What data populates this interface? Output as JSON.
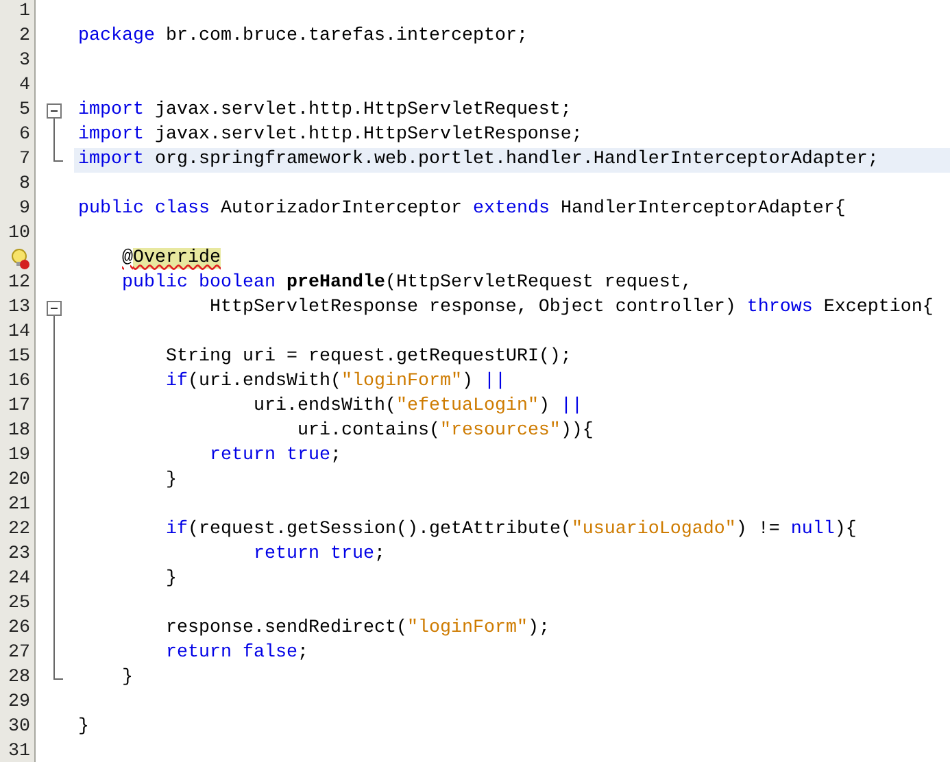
{
  "editor": {
    "lines": [
      {
        "number": "1",
        "kind": "plain",
        "current": false
      },
      {
        "number": "2",
        "kind": "plain",
        "current": false,
        "tokens": [
          {
            "kind": "keyword",
            "text": "package"
          },
          {
            "kind": "plain",
            "text": " br.com.bruce.tarefas.interceptor;"
          }
        ]
      },
      {
        "number": "3",
        "kind": "plain",
        "current": false
      },
      {
        "number": "4",
        "kind": "plain",
        "current": false
      },
      {
        "number": "5",
        "kind": "foldstart",
        "current": false,
        "tokens": [
          {
            "kind": "keyword",
            "text": "import"
          },
          {
            "kind": "plain",
            "text": " javax.servlet.http.HttpServletRequest;"
          }
        ]
      },
      {
        "number": "6",
        "kind": "foldbody",
        "current": false,
        "tokens": [
          {
            "kind": "keyword",
            "text": "import"
          },
          {
            "kind": "plain",
            "text": " javax.servlet.http.HttpServletResponse;"
          }
        ]
      },
      {
        "number": "7",
        "kind": "foldend",
        "current": true,
        "tokens": [
          {
            "kind": "keyword",
            "text": "import"
          },
          {
            "kind": "plain",
            "text": " org.springframework.web.portlet.handler.HandlerInterceptorAdapter;"
          }
        ]
      },
      {
        "number": "8",
        "kind": "plain",
        "current": false
      },
      {
        "number": "9",
        "kind": "plain",
        "current": false,
        "tokens": [
          {
            "kind": "keyword",
            "text": "public class"
          },
          {
            "kind": "plain",
            "text": " AutorizadorInterceptor "
          },
          {
            "kind": "keyword",
            "text": "extends"
          },
          {
            "kind": "plain",
            "text": " HandlerInterceptorAdapter{"
          }
        ]
      },
      {
        "number": "10",
        "kind": "plain",
        "current": false
      },
      {
        "kind": "hint",
        "current": false,
        "tokens": [
          {
            "kind": "error",
            "text": "    @"
          },
          {
            "kind": "error-highlight",
            "text": "Override"
          }
        ]
      },
      {
        "number": "12",
        "kind": "plain",
        "current": false,
        "tokens": [
          {
            "kind": "keyword",
            "text": "    public boolean "
          },
          {
            "kind": "bold",
            "text": "preHandle"
          },
          {
            "kind": "plain",
            "text": "(HttpServletRequest request,"
          }
        ]
      },
      {
        "number": "13",
        "kind": "foldstart",
        "current": false,
        "tokens": [
          {
            "kind": "plain",
            "text": "            HttpServletResponse response, Object controller) "
          },
          {
            "kind": "keyword",
            "text": "throws"
          },
          {
            "kind": "plain",
            "text": " Exception{"
          }
        ]
      },
      {
        "number": "14",
        "kind": "foldbody",
        "current": false
      },
      {
        "number": "15",
        "kind": "foldbody",
        "current": false,
        "tokens": [
          {
            "kind": "plain",
            "text": "        String uri = request.getRequestURI();"
          }
        ]
      },
      {
        "number": "16",
        "kind": "foldbody",
        "current": false,
        "tokens": [
          {
            "kind": "keyword",
            "text": "        if"
          },
          {
            "kind": "plain",
            "text": "(uri.endsWith("
          },
          {
            "kind": "string",
            "text": "\"loginForm\""
          },
          {
            "kind": "plain",
            "text": ") "
          },
          {
            "kind": "keyword",
            "text": "||"
          }
        ]
      },
      {
        "number": "17",
        "kind": "foldbody",
        "current": false,
        "tokens": [
          {
            "kind": "plain",
            "text": "                uri.endsWith("
          },
          {
            "kind": "string",
            "text": "\"efetuaLogin\""
          },
          {
            "kind": "plain",
            "text": ") "
          },
          {
            "kind": "keyword",
            "text": "||"
          }
        ]
      },
      {
        "number": "18",
        "kind": "foldbody",
        "current": false,
        "tokens": [
          {
            "kind": "plain",
            "text": "                    uri.contains("
          },
          {
            "kind": "string",
            "text": "\"resources\""
          },
          {
            "kind": "plain",
            "text": ")){"
          }
        ]
      },
      {
        "number": "19",
        "kind": "foldbody",
        "current": false,
        "tokens": [
          {
            "kind": "keyword",
            "text": "            return true"
          },
          {
            "kind": "plain",
            "text": ";"
          }
        ]
      },
      {
        "number": "20",
        "kind": "foldbody",
        "current": false,
        "tokens": [
          {
            "kind": "plain",
            "text": "        }"
          }
        ]
      },
      {
        "number": "21",
        "kind": "foldbody",
        "current": false
      },
      {
        "number": "22",
        "kind": "foldbody",
        "current": false,
        "tokens": [
          {
            "kind": "keyword",
            "text": "        if"
          },
          {
            "kind": "plain",
            "text": "(request.getSession().getAttribute("
          },
          {
            "kind": "string",
            "text": "\"usuarioLogado\""
          },
          {
            "kind": "plain",
            "text": ") != "
          },
          {
            "kind": "keyword",
            "text": "null"
          },
          {
            "kind": "plain",
            "text": "){"
          }
        ]
      },
      {
        "number": "23",
        "kind": "foldbody",
        "current": false,
        "tokens": [
          {
            "kind": "keyword",
            "text": "                return true"
          },
          {
            "kind": "plain",
            "text": ";"
          }
        ]
      },
      {
        "number": "24",
        "kind": "foldbody",
        "current": false,
        "tokens": [
          {
            "kind": "plain",
            "text": "        }"
          }
        ]
      },
      {
        "number": "25",
        "kind": "foldbody",
        "current": false
      },
      {
        "number": "26",
        "kind": "foldbody",
        "current": false,
        "tokens": [
          {
            "kind": "plain",
            "text": "        response.sendRedirect("
          },
          {
            "kind": "string",
            "text": "\"loginForm\""
          },
          {
            "kind": "plain",
            "text": ");"
          }
        ]
      },
      {
        "number": "27",
        "kind": "foldbody",
        "current": false,
        "tokens": [
          {
            "kind": "keyword",
            "text": "        return false"
          },
          {
            "kind": "plain",
            "text": ";"
          }
        ]
      },
      {
        "number": "28",
        "kind": "foldend",
        "current": false,
        "tokens": [
          {
            "kind": "plain",
            "text": "    }"
          }
        ]
      },
      {
        "number": "29",
        "kind": "plain",
        "current": false
      },
      {
        "number": "30",
        "kind": "plain",
        "current": false,
        "tokens": [
          {
            "kind": "plain",
            "text": "}"
          }
        ]
      },
      {
        "number": "31",
        "kind": "plain",
        "current": false
      }
    ]
  }
}
